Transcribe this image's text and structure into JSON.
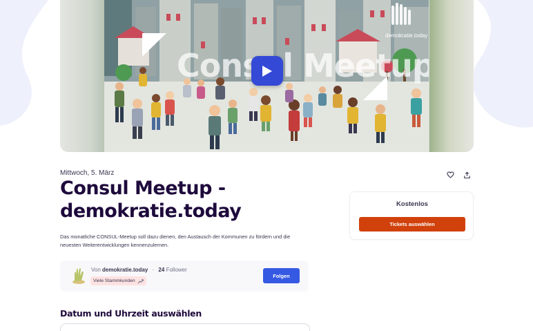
{
  "hero": {
    "video_title": "Consul Meetup",
    "brand_watermark": "demokratie.today",
    "play_icon": "play-icon"
  },
  "event": {
    "date": "Mittwoch, 5. März",
    "title": "Consul Meetup - demokratie.today",
    "summary": "Das monatliche CONSUL-Meetup soll dazu dienen, den Austausch der Kommunen zu fördern und die neuesten Weiterentwicklungen kennenzulernen."
  },
  "actions": {
    "like_icon": "heart-icon",
    "share_icon": "share-icon"
  },
  "ticket": {
    "price": "Kostenlos",
    "button_label": "Tickets auswählen",
    "button_color": "#d1410c"
  },
  "organizer": {
    "by_prefix": "Von",
    "name": "demokratie.today",
    "followers_count": "24",
    "followers_label": "Follower",
    "badge": "Viele Stammkunden",
    "badge_icon": "trend-up-icon",
    "follow_label": "Folgen",
    "follow_color": "#3659e3"
  },
  "sections": {
    "date_time_title": "Datum und Uhrzeit auswählen"
  }
}
